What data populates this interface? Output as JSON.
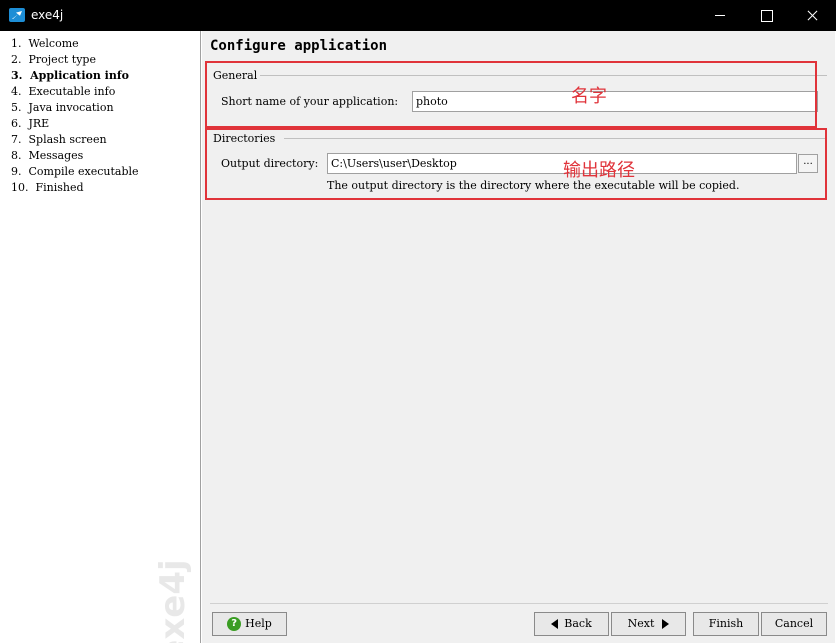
{
  "window": {
    "title": "exe4j"
  },
  "steps": [
    {
      "label": "1.  Welcome"
    },
    {
      "label": "2.  Project type"
    },
    {
      "label": "3.  Application info"
    },
    {
      "label": "4.  Executable info"
    },
    {
      "label": "5.  Java invocation"
    },
    {
      "label": "6.  JRE"
    },
    {
      "label": "7.  Splash screen"
    },
    {
      "label": "8.  Messages"
    },
    {
      "label": "9.  Compile executable"
    },
    {
      "label": "10.  Finished"
    }
  ],
  "watermark": "exe4j",
  "page": {
    "title": "Configure application",
    "general": {
      "label": "General",
      "short_name_label": "Short name of your application:",
      "short_name_value": "photo"
    },
    "directories": {
      "label": "Directories",
      "output_label": "Output directory:",
      "output_value": "C:\\Users\\user\\Desktop",
      "browse_label": "...",
      "hint": "The output directory is the directory where the executable will be copied."
    }
  },
  "annotations": {
    "name": "名字",
    "output_path": "输出路径",
    "color": "#e0333a"
  },
  "buttons": {
    "help": "Help",
    "back": "Back",
    "next": "Next",
    "finish": "Finish",
    "cancel": "Cancel"
  }
}
